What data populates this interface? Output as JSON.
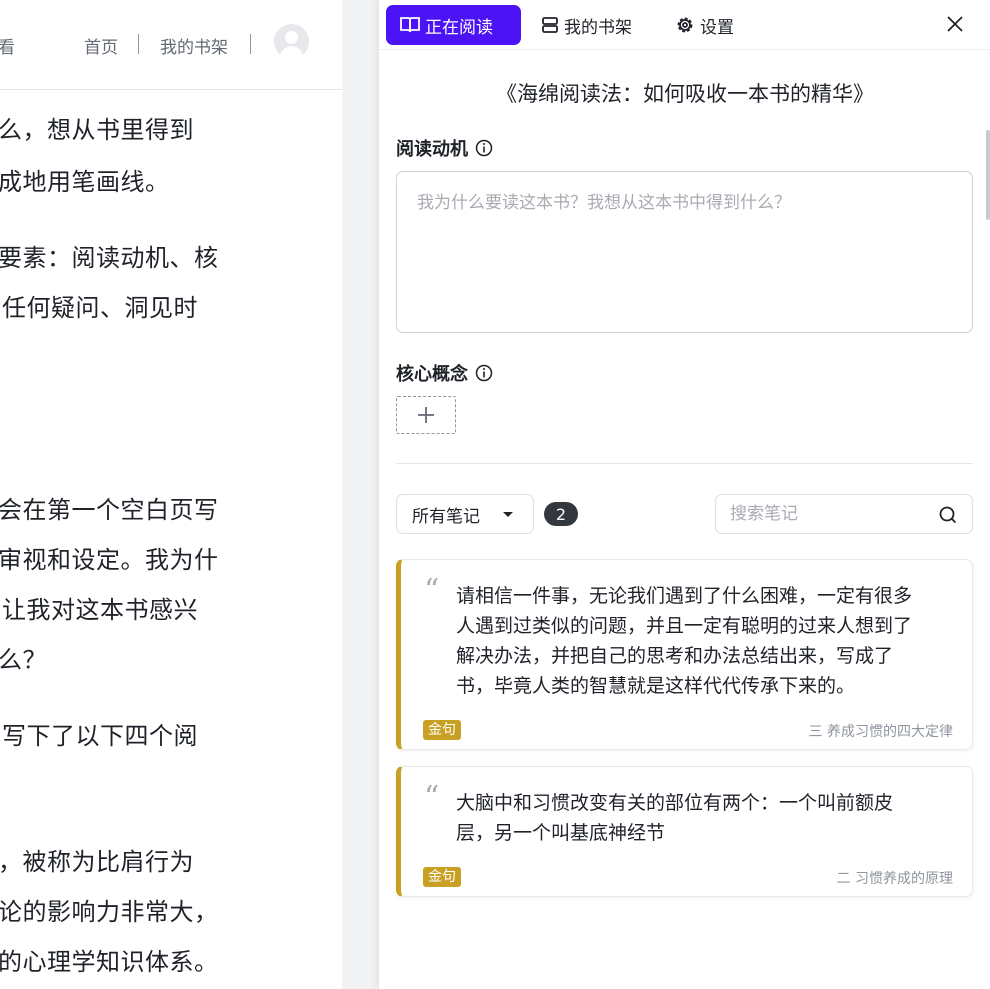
{
  "reader": {
    "nav": {
      "partial_left": "看",
      "home": "首页",
      "bookshelf": "我的书架"
    },
    "lines": [
      "么，想从书里得到",
      "成地用笔画线。",
      "要素：阅读动机、核",
      "任何疑问、洞见时",
      "会在第一个空白页写",
      "审视和设定。我为什",
      "让我对这本书感兴",
      "么？",
      "写下了以下四个阅",
      "，被称为比肩行为",
      "论的影响力非常大，",
      "的心理学知识体系。"
    ]
  },
  "panel": {
    "tabs": [
      {
        "label": "正在阅读",
        "icon": "book-open-icon"
      },
      {
        "label": "我的书架",
        "icon": "bookshelf-icon"
      },
      {
        "label": "设置",
        "icon": "gear-icon"
      }
    ],
    "book_title": "《海绵阅读法：如何吸收一本书的精华》",
    "motivation": {
      "title": "阅读动机",
      "placeholder": "我为什么要读这本书？我想从这本书中得到什么？"
    },
    "concepts": {
      "title": "核心概念"
    },
    "notes_filter": "所有笔记",
    "notes_count": "2",
    "search_placeholder": "搜索笔记",
    "notes": [
      {
        "lines": [
          "请相信一件事，无论我们遇到了什么困难，一定有很多",
          "人遇到过类似的问题，并且一定有聪明的过来人想到了",
          "解决办法，并把自己的思考和办法总结出来，写成了",
          "书，毕竟人类的智慧就是这样代代传承下来的。"
        ],
        "tag": "金句",
        "chapter": "三 养成习惯的四大定律"
      },
      {
        "lines": [
          "大脑中和习惯改变有关的部位有两个：一个叫前额皮",
          "层，另一个叫基底神经节"
        ],
        "tag": "金句",
        "chapter": "二 习惯养成的原理"
      }
    ],
    "colors": {
      "accent": "#4b13f6",
      "tag": "#c8a024"
    }
  }
}
